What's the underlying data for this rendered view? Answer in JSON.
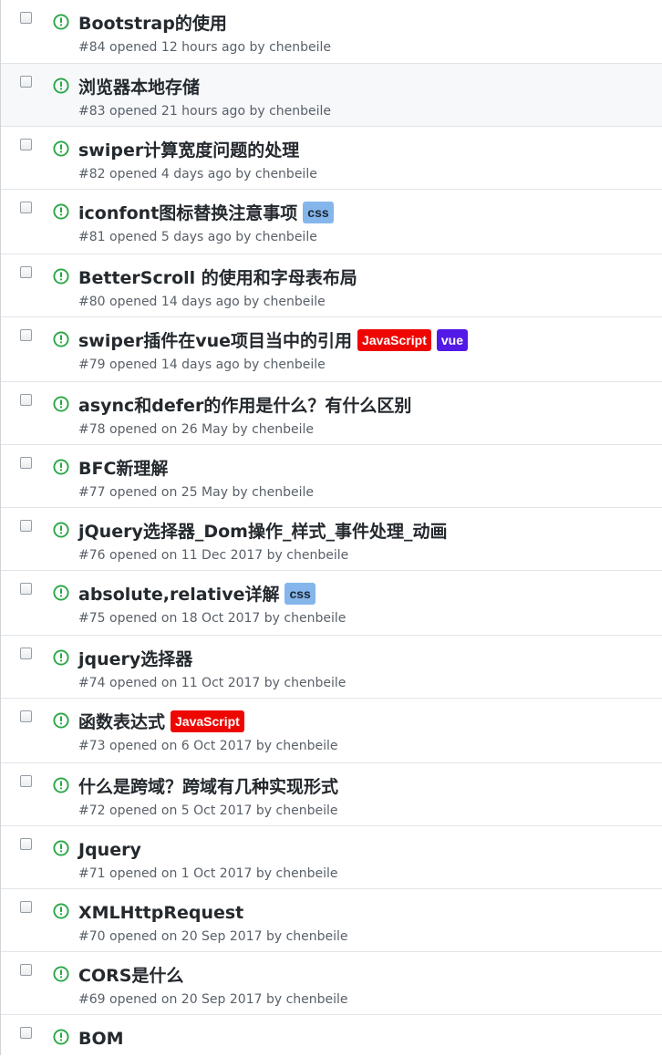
{
  "colors": {
    "open_icon": "#28a745",
    "row_hover_bg": "#f6f8fa",
    "border": "#e1e4e8",
    "title": "#24292e",
    "meta": "#586069"
  },
  "icons": {
    "checkbox": "checkbox-icon",
    "open": "issue-opened-icon"
  },
  "issues": [
    {
      "title": "Bootstrap的使用",
      "number": "#84",
      "opened_prefix": "opened",
      "time": "12 hours ago",
      "by": "by",
      "author": "chenbeile",
      "labels": [],
      "highlighted": false
    },
    {
      "title": "浏览器本地存储",
      "number": "#83",
      "opened_prefix": "opened",
      "time": "21 hours ago",
      "by": "by",
      "author": "chenbeile",
      "labels": [],
      "highlighted": true
    },
    {
      "title": "swiper计算宽度问题的处理",
      "number": "#82",
      "opened_prefix": "opened",
      "time": "4 days ago",
      "by": "by",
      "author": "chenbeile",
      "labels": [],
      "highlighted": false
    },
    {
      "title": "iconfont图标替换注意事项",
      "number": "#81",
      "opened_prefix": "opened",
      "time": "5 days ago",
      "by": "by",
      "author": "chenbeile",
      "labels": [
        {
          "name": "css",
          "bg": "#84b6eb",
          "fg": "#1c2733"
        }
      ],
      "highlighted": false
    },
    {
      "title": "BetterScroll 的使用和字母表布局",
      "number": "#80",
      "opened_prefix": "opened",
      "time": "14 days ago",
      "by": "by",
      "author": "chenbeile",
      "labels": [],
      "highlighted": false
    },
    {
      "title": "swiper插件在vue项目当中的引用",
      "number": "#79",
      "opened_prefix": "opened",
      "time": "14 days ago",
      "by": "by",
      "author": "chenbeile",
      "labels": [
        {
          "name": "JavaScript",
          "bg": "#ee0701",
          "fg": "#ffffff"
        },
        {
          "name": "vue",
          "bg": "#5319e7",
          "fg": "#ffffff"
        }
      ],
      "highlighted": false
    },
    {
      "title": "async和defer的作用是什么？有什么区别",
      "number": "#78",
      "opened_prefix": "opened on",
      "time": "26 May",
      "by": "by",
      "author": "chenbeile",
      "labels": [],
      "highlighted": false
    },
    {
      "title": "BFC新理解",
      "number": "#77",
      "opened_prefix": "opened on",
      "time": "25 May",
      "by": "by",
      "author": "chenbeile",
      "labels": [],
      "highlighted": false
    },
    {
      "title": "jQuery选择器_Dom操作_样式_事件处理_动画",
      "number": "#76",
      "opened_prefix": "opened on",
      "time": "11 Dec 2017",
      "by": "by",
      "author": "chenbeile",
      "labels": [],
      "highlighted": false
    },
    {
      "title": "absolute,relative详解",
      "number": "#75",
      "opened_prefix": "opened on",
      "time": "18 Oct 2017",
      "by": "by",
      "author": "chenbeile",
      "labels": [
        {
          "name": "css",
          "bg": "#84b6eb",
          "fg": "#1c2733"
        }
      ],
      "highlighted": false
    },
    {
      "title": "jquery选择器",
      "number": "#74",
      "opened_prefix": "opened on",
      "time": "11 Oct 2017",
      "by": "by",
      "author": "chenbeile",
      "labels": [],
      "highlighted": false
    },
    {
      "title": "函数表达式",
      "number": "#73",
      "opened_prefix": "opened on",
      "time": "6 Oct 2017",
      "by": "by",
      "author": "chenbeile",
      "labels": [
        {
          "name": "JavaScript",
          "bg": "#ee0701",
          "fg": "#ffffff"
        }
      ],
      "highlighted": false
    },
    {
      "title": "什么是跨域？跨域有几种实现形式",
      "number": "#72",
      "opened_prefix": "opened on",
      "time": "5 Oct 2017",
      "by": "by",
      "author": "chenbeile",
      "labels": [],
      "highlighted": false
    },
    {
      "title": "Jquery",
      "number": "#71",
      "opened_prefix": "opened on",
      "time": "1 Oct 2017",
      "by": "by",
      "author": "chenbeile",
      "labels": [],
      "highlighted": false
    },
    {
      "title": "XMLHttpRequest",
      "number": "#70",
      "opened_prefix": "opened on",
      "time": "20 Sep 2017",
      "by": "by",
      "author": "chenbeile",
      "labels": [],
      "highlighted": false
    },
    {
      "title": "CORS是什么",
      "number": "#69",
      "opened_prefix": "opened on",
      "time": "20 Sep 2017",
      "by": "by",
      "author": "chenbeile",
      "labels": [],
      "highlighted": false
    },
    {
      "title": "BOM",
      "number": "",
      "opened_prefix": "",
      "time": "",
      "by": "",
      "author": "",
      "labels": [],
      "highlighted": false
    }
  ]
}
